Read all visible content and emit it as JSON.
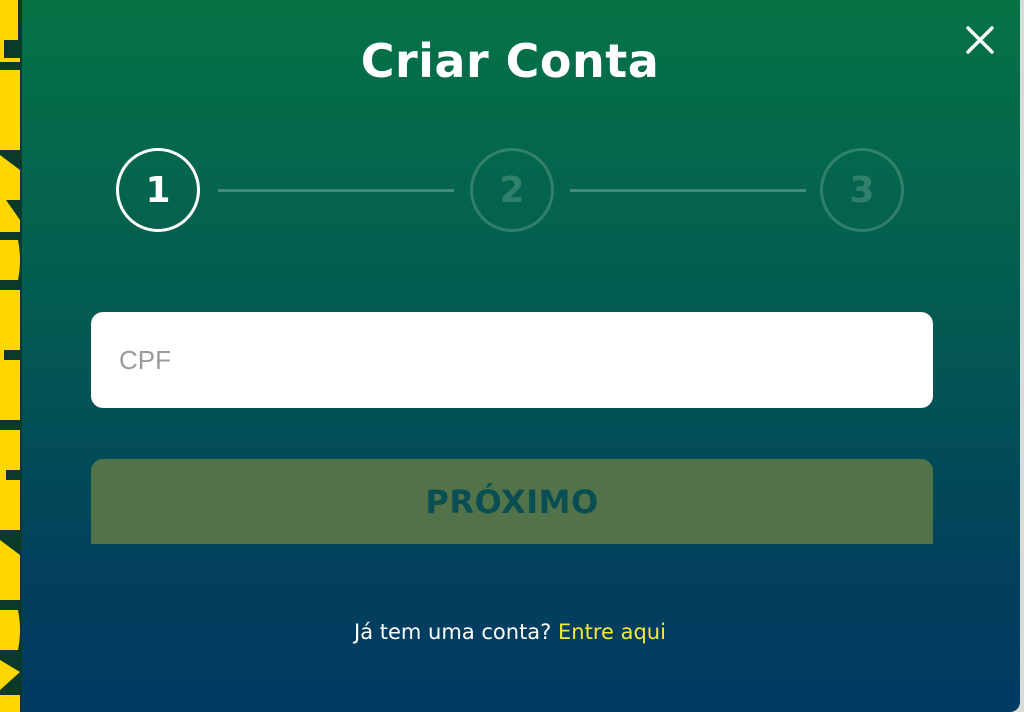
{
  "modal": {
    "title": "Criar Conta",
    "close_icon": "close-icon"
  },
  "stepper": {
    "steps": [
      {
        "label": "1",
        "state": "active"
      },
      {
        "label": "2",
        "state": "inactive"
      },
      {
        "label": "3",
        "state": "inactive"
      }
    ]
  },
  "form": {
    "cpf": {
      "placeholder": "CPF",
      "value": ""
    },
    "next_button_label": "PRÓXIMO"
  },
  "footer": {
    "prompt": "Já tem uma conta?",
    "link_label": "Entre aqui"
  },
  "colors": {
    "gradient_top": "#057345",
    "gradient_bottom": "#013a63",
    "link": "#f3e93a",
    "button_bg": "#527349",
    "button_text": "#0a4d52",
    "side_art": "#ffd700"
  }
}
